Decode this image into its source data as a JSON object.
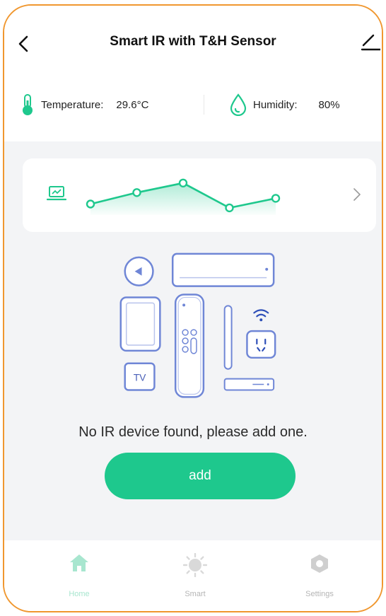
{
  "header": {
    "title": "Smart IR with T&H Sensor"
  },
  "sensors": {
    "temperature": {
      "label": "Temperature:",
      "value": "29.6°C"
    },
    "humidity": {
      "label": "Humidity:",
      "value": "80%"
    }
  },
  "chart_card": {
    "icon": "laptop-chart-icon",
    "trend_points": [
      0.25,
      0.55,
      0.8,
      0.15,
      0.4
    ]
  },
  "device_illustration": {
    "tv_label": "TV"
  },
  "empty_state": {
    "message": "No IR device found,  please add one.",
    "add_label": "add"
  },
  "tabbar": {
    "items": [
      {
        "label": "Home",
        "icon": "home-icon",
        "active": true
      },
      {
        "label": "Smart",
        "icon": "sun-icon",
        "active": false
      },
      {
        "label": "Settings",
        "icon": "hexagon-icon",
        "active": false
      }
    ]
  },
  "colors": {
    "accent": "#1ec88d",
    "frame": "#f0972f",
    "background": "#f3f4f6"
  }
}
